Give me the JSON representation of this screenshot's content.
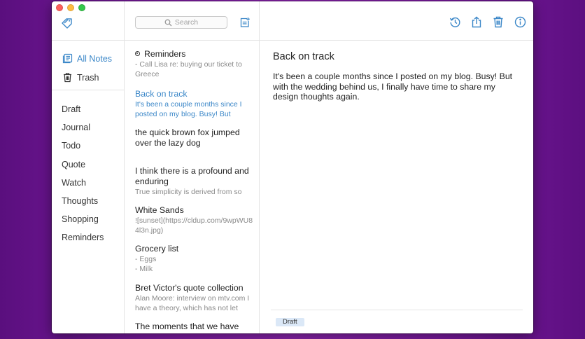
{
  "sidebar": {
    "nav": [
      {
        "label": "All Notes",
        "icon": "notes-icon",
        "active": true
      },
      {
        "label": "Trash",
        "icon": "trash-icon",
        "active": false
      }
    ],
    "tags": [
      "Draft",
      "Journal",
      "Todo",
      "Quote",
      "Watch",
      "Thoughts",
      "Shopping",
      "Reminders"
    ]
  },
  "notelist": {
    "search_placeholder": "Search",
    "notes": [
      {
        "title": "Reminders",
        "preview": "- Call Lisa re: buying our ticket to Greece"
      },
      {
        "title": "Back on track",
        "preview": "It's been a couple months since I posted on my blog. Busy! But"
      },
      {
        "title": "the quick brown fox jumped over the lazy dog",
        "preview": ""
      },
      {
        "title": "I think there is a profound and enduring",
        "preview": "True simplicity is derived from so"
      },
      {
        "title": "White Sands",
        "preview": "![sunset](https://cldup.com/9wpWU84l3n.jpg)"
      },
      {
        "title": "Grocery list",
        "preview": "- Eggs\n- Milk"
      },
      {
        "title": "Bret Victor's quote collection",
        "preview": "Alan Moore: interview on mtv.com I have a theory, which has not let"
      },
      {
        "title": "The moments that we have",
        "preview": ""
      }
    ]
  },
  "editor": {
    "title": "Back on track",
    "body": "It's been a couple months since I posted on my blog. Busy! But with the wedding behind us, I finally have time to share my design thoughts again.",
    "tag": "Draft"
  },
  "colors": {
    "accent": "#3b87c8",
    "background": "#7a1a9f"
  }
}
